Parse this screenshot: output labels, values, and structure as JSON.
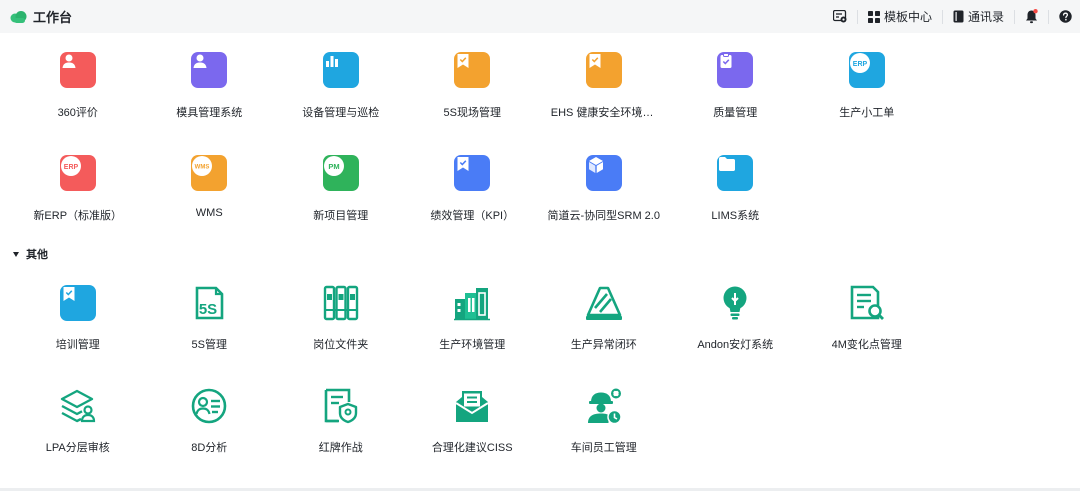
{
  "header": {
    "title": "工作台",
    "logo_icon": "cloud-logo-icon",
    "actions": [
      {
        "label": "",
        "icon": "form-settings-icon"
      },
      {
        "label": "模板中心",
        "icon": "grid-icon"
      },
      {
        "label": "通讯录",
        "icon": "contacts-book-icon"
      },
      {
        "label": "",
        "icon": "bell-icon",
        "badge_color": "#f54a45"
      },
      {
        "label": "",
        "icon": "help-icon"
      }
    ]
  },
  "apps": [
    {
      "label": "360评价",
      "icon": "person-icon",
      "color": "#f45b5b"
    },
    {
      "label": "模具管理系统",
      "icon": "person-icon",
      "color": "#7b68ee"
    },
    {
      "label": "设备管理与巡检",
      "icon": "bar-chart-icon",
      "color": "#1fa6e0"
    },
    {
      "label": "5S现场管理",
      "icon": "bookmark-check-icon",
      "color": "#f3a22f"
    },
    {
      "label": "EHS 健康安全环境管理",
      "icon": "bookmark-check-icon",
      "color": "#f3a22f"
    },
    {
      "label": "质量管理",
      "icon": "clipboard-check-icon",
      "color": "#7b68ee"
    },
    {
      "label": "生产小工单",
      "icon": "erp-badge-icon",
      "color": "#1fa6e0",
      "badge": "ERP"
    },
    {
      "label": "新ERP（标准版）",
      "icon": "erp-badge-icon",
      "color": "#f45b5b",
      "badge": "ERP"
    },
    {
      "label": "WMS",
      "icon": "wms-badge-icon",
      "color": "#f3a22f",
      "badge": "WMS"
    },
    {
      "label": "新项目管理",
      "icon": "pm-badge-icon",
      "color": "#2fb35b",
      "badge": "PM"
    },
    {
      "label": "绩效管理（KPI）",
      "icon": "bookmark-check-icon",
      "color": "#4a7cf6"
    },
    {
      "label": "简道云-协同型SRM 2.0",
      "icon": "cube-icon",
      "color": "#4a7cf6"
    },
    {
      "label": "LIMS系统",
      "icon": "folder-icon",
      "color": "#1fa6e0"
    }
  ],
  "section": {
    "title": "其他"
  },
  "other_apps": [
    {
      "label": "培训管理",
      "icon": "bookmark-check-icon",
      "color": "#1fa6e0"
    },
    {
      "label": "5S管理",
      "icon": "5s-document-icon",
      "color": "#14a57f",
      "badge": "5S"
    },
    {
      "label": "岗位文件夹",
      "icon": "binders-icon",
      "color": "#14a57f"
    },
    {
      "label": "生产环境管理",
      "icon": "factory-icon",
      "color": "#14a57f"
    },
    {
      "label": "生产异常闭环",
      "icon": "warning-triangle-icon",
      "color": "#14a57f"
    },
    {
      "label": "Andon安灯系统",
      "icon": "lightbulb-icon",
      "color": "#14a57f"
    },
    {
      "label": "4M变化点管理",
      "icon": "document-search-icon",
      "color": "#14a57f"
    },
    {
      "label": "LPA分层审核",
      "icon": "layers-person-icon",
      "color": "#14a57f"
    },
    {
      "label": "8D分析",
      "icon": "user-list-icon",
      "color": "#14a57f"
    },
    {
      "label": "红牌作战",
      "icon": "document-shield-icon",
      "color": "#14a57f"
    },
    {
      "label": "合理化建议CISS",
      "icon": "envelope-icon",
      "color": "#14a57f"
    },
    {
      "label": "车间员工管理",
      "icon": "worker-clock-icon",
      "color": "#14a57f"
    }
  ]
}
